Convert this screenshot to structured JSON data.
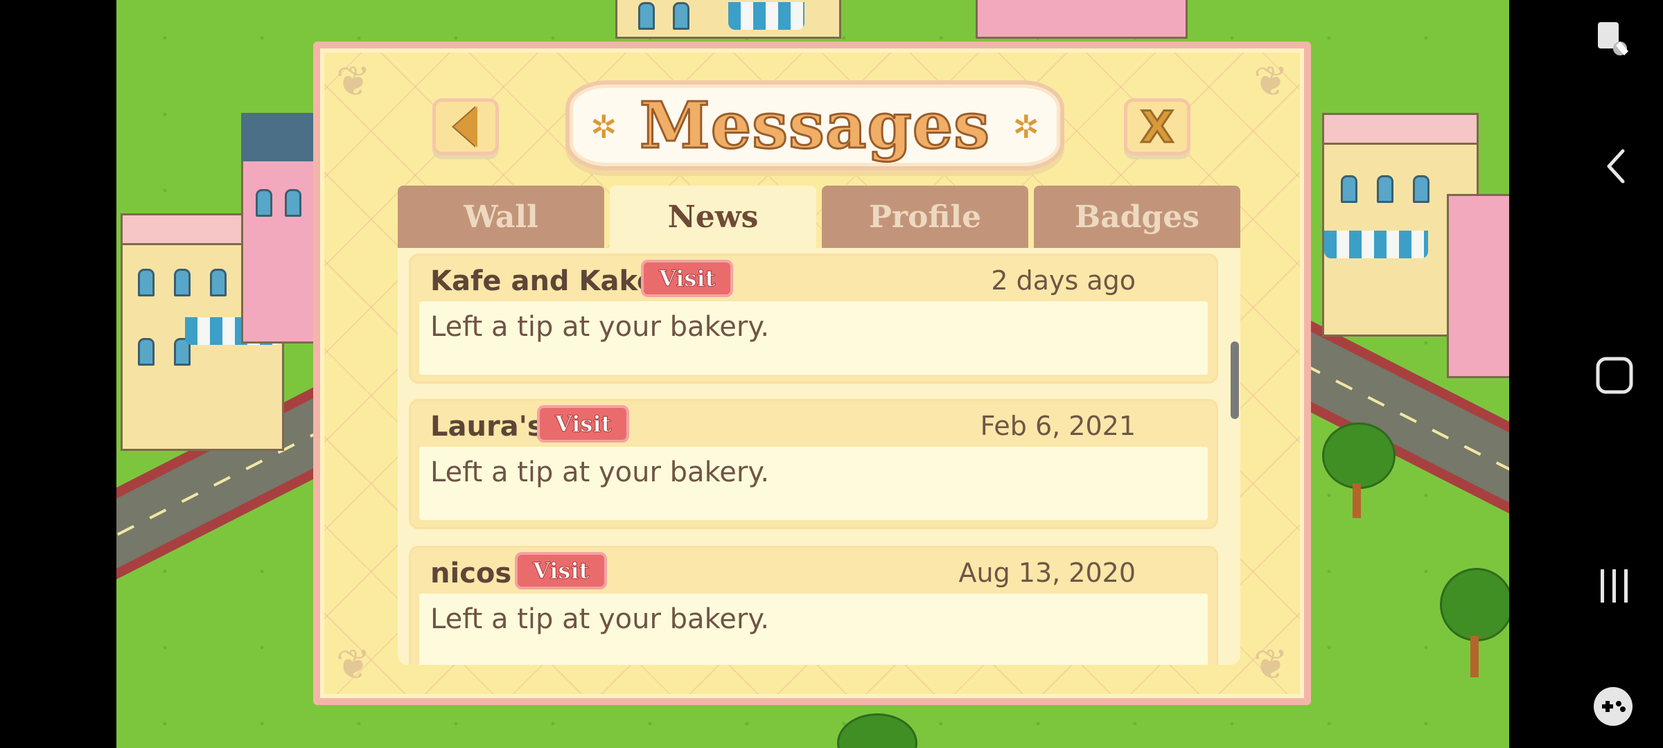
{
  "dialog": {
    "title": "Messages",
    "close_label": "X"
  },
  "tabs": [
    {
      "label": "Wall",
      "active": false
    },
    {
      "label": "News",
      "active": true
    },
    {
      "label": "Profile",
      "active": false
    },
    {
      "label": "Badges",
      "active": false
    }
  ],
  "messages": [
    {
      "name": "Kafe and Kake",
      "visit_label": "Visit",
      "date": "2 days ago",
      "text": "Left a tip at your bakery."
    },
    {
      "name": "Laura's",
      "visit_label": "Visit",
      "date": "Feb 6, 2021",
      "text": "Left a tip at your bakery."
    },
    {
      "name": "nicos",
      "visit_label": "Visit",
      "date": "Aug 13, 2020",
      "text": "Left a tip at your bakery."
    }
  ],
  "system_nav": {
    "icons": [
      "screen-touch-icon",
      "back-arrow-icon",
      "home-icon",
      "recents-icon",
      "game-tools-icon"
    ]
  },
  "colors": {
    "grass": "#7cc63e",
    "dialog_bg": "#fbeb9f",
    "dialog_border": "#f4b5a9",
    "tab_inactive": "#c2957a",
    "tab_active": "#fdf3c8",
    "visit_button": "#ea6b6b",
    "title_text": "#f0ae66"
  }
}
